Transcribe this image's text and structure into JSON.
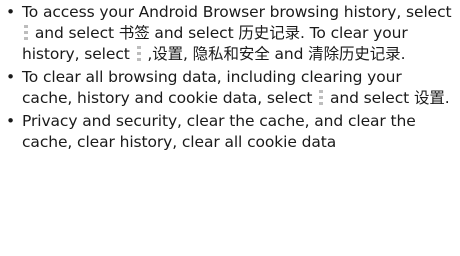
{
  "items": [
    {
      "segments": [
        "To access your Android Browser browsing history, select ",
        " and select 书签 and select 历史记录. To clear your history, select ",
        " ,设置, 隐私和安全 and 清除历史记录."
      ],
      "icon": "menu-icon"
    },
    {
      "segments": [
        "To clear all browsing data, including clearing your cache, history and cookie data, select ",
        " and select 设置."
      ],
      "icon": "menu-icon"
    },
    {
      "segments": [
        "Privacy and security, clear the cache, and clear the cache, clear history, clear all cookie data"
      ]
    }
  ],
  "bullet_symbol": "•"
}
